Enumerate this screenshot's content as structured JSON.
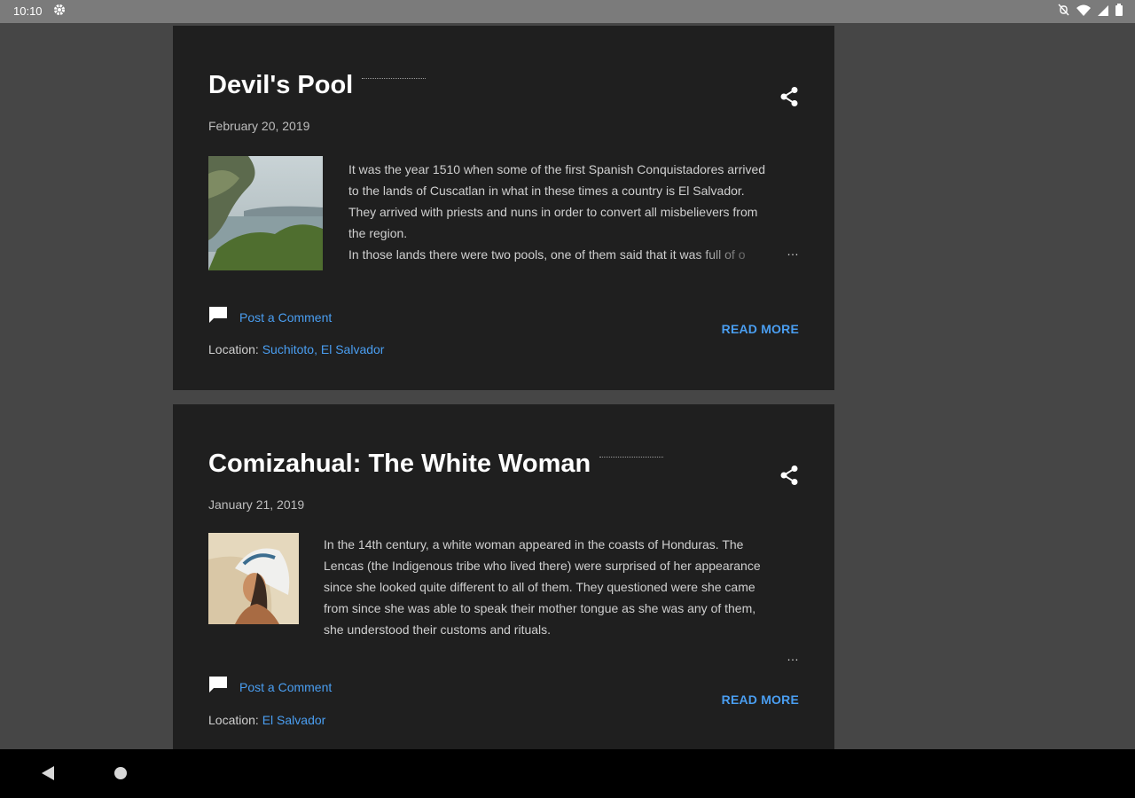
{
  "status_bar": {
    "time": "10:10",
    "icons": [
      "gear-icon",
      "alarm-off-icon",
      "wifi-icon",
      "signal-icon",
      "battery-icon"
    ]
  },
  "posts": [
    {
      "title": "Devil's Pool",
      "date": "February 20, 2019",
      "excerpt_lines": [
        "It was the year 1510 when some of the first Spanish Conquistadores arrived",
        "to the lands of Cuscatlan in what in these times a country is El Salvador.",
        "They arrived with priests and nuns in order to convert all misbelievers from",
        "the region.",
        "In those lands there were two pools, one of them said that it was full of o"
      ],
      "ellipsis": "…",
      "comment_label": "Post a Comment",
      "read_more": "READ MORE",
      "location_label": "Location:",
      "location_value": "Suchitoto, El Salvador"
    },
    {
      "title": "Comizahual: The White Woman",
      "date": "January 21, 2019",
      "excerpt_lines": [
        "In the 14th century, a white woman appeared in the coasts of Honduras. The",
        "Lencas (the Indigenous tribe who lived there) were surprised of her appearance",
        "since she looked quite different to all of them. They questioned were she came",
        "from since she was able to speak their mother tongue as she was any of them,",
        "she understood their customs and rituals."
      ],
      "ellipsis": "…",
      "comment_label": "Post a Comment",
      "read_more": "READ MORE",
      "location_label": "Location:",
      "location_value": "El Salvador"
    }
  ],
  "colors": {
    "page_background": "#464646",
    "card_background": "#1f1f1f",
    "link": "#4a9ef1",
    "status_bar": "#7b7b7b",
    "nav_bar": "#000000"
  },
  "nav_bar": {
    "icons": [
      "back-icon",
      "home-icon"
    ]
  }
}
